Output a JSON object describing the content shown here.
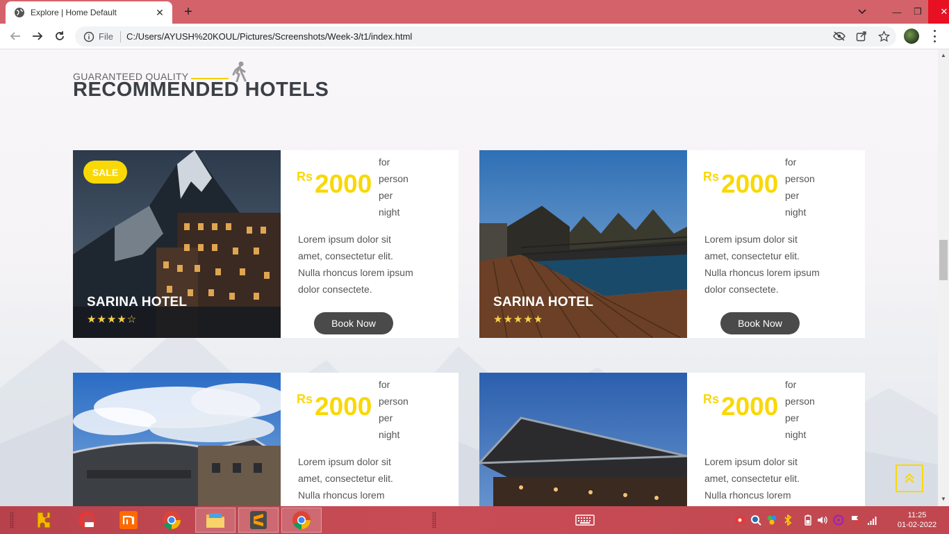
{
  "browser": {
    "tab_title": "Explore | Home Default",
    "address_scheme": "File",
    "address_url": "C:/Users/AYUSH%20KOUL/Pictures/Screenshots/Week-3/t1/index.html"
  },
  "section": {
    "eyebrow": "GUARANTEED QUALITY",
    "title": "RECOMMENDED HOTELS"
  },
  "hotels": [
    {
      "name": "SARINA HOTEL",
      "badge": "SALE",
      "stars": "★★★★☆",
      "rating": 4,
      "currency": "Rs",
      "price": "2000",
      "per": [
        "for",
        "person",
        "per",
        "night"
      ],
      "description": "Lorem ipsum dolor sit amet, consectetur elit. Nulla rhoncus lorem ipsum dolor consectete.",
      "button": "Book Now"
    },
    {
      "name": "SARINA HOTEL",
      "stars": "★★★★★",
      "rating": 5,
      "currency": "Rs",
      "price": "2000",
      "per": [
        "for",
        "person",
        "per",
        "night"
      ],
      "description": "Lorem ipsum dolor sit amet, consectetur elit. Nulla rhoncus lorem ipsum dolor consectete.",
      "button": "Book Now"
    },
    {
      "currency": "Rs",
      "price": "2000",
      "per": [
        "for",
        "person",
        "per",
        "night"
      ],
      "description": "Lorem ipsum dolor sit amet, consectetur elit. Nulla rhoncus lorem"
    },
    {
      "currency": "Rs",
      "price": "2000",
      "per": [
        "for",
        "person",
        "per",
        "night"
      ],
      "description": "Lorem ipsum dolor sit amet, consectetur elit. Nulla rhoncus lorem"
    }
  ],
  "colors": {
    "accent_yellow": "#f9d806",
    "button_dark": "#4a4a4a",
    "title_dark": "#3b3f46",
    "tabbar": "#d4626a"
  },
  "taskbar": {
    "time": "11:25",
    "date": "01-02-2022"
  }
}
